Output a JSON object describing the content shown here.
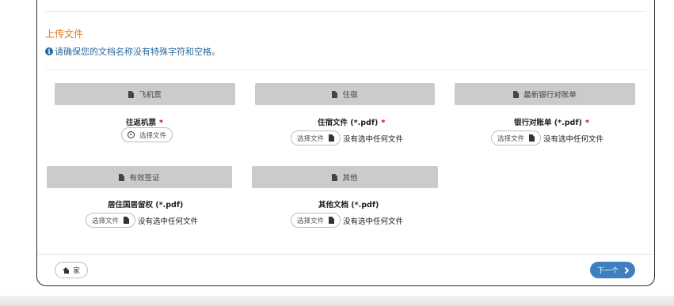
{
  "upload": {
    "title": "上传文件",
    "notice": "请确保您的文档名称没有特殊字符和空格。"
  },
  "sections": [
    {
      "header": "飞机票",
      "field_label": "往返机票",
      "required": "*",
      "button": "选择文件",
      "status": ""
    },
    {
      "header": "住宿",
      "field_label": "住宿文件 (*.pdf)",
      "required": "*",
      "button": "选择文件",
      "status": "没有选中任何文件"
    },
    {
      "header": "最新银行对账单",
      "field_label": "银行对账单 (*.pdf)",
      "required": "*",
      "button": "选择文件",
      "status": "没有选中任何文件"
    },
    {
      "header": "有效签证",
      "field_label": "居住国居留权 (*.pdf)",
      "required": "",
      "button": "选择文件",
      "status": "没有选中任何文件"
    },
    {
      "header": "其他",
      "field_label": "其他文档 (*.pdf)",
      "required": "",
      "button": "选择文件",
      "status": "没有选中任何文件"
    }
  ],
  "footer": {
    "home_label": "家",
    "next_label": "下一个"
  }
}
